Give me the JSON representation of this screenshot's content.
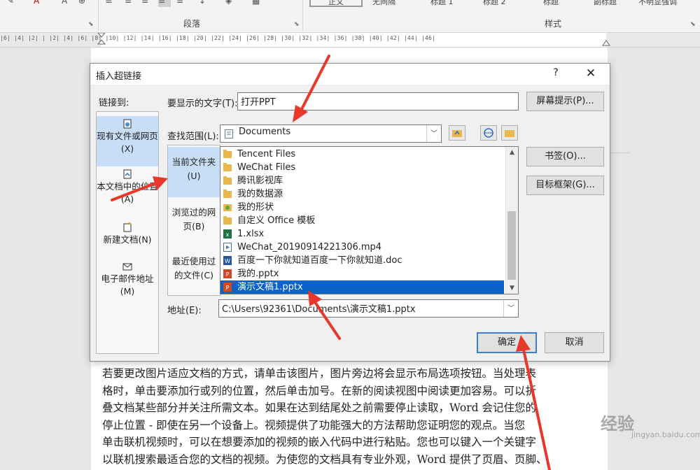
{
  "ribbon": {
    "paragraph_group": "段落",
    "styles_group": "样式",
    "style_items": [
      "正文",
      "无间隔",
      "标题 1",
      "标题 2",
      "标题",
      "副标题",
      "不明显强调"
    ]
  },
  "ruler": {
    "ticks": "|6| |4| |2| |  |2| |4| |6| |8| |10| |12| |14| |16| |18| |20| |22| |24| |26| |28| |30| |32| |34| |36| |38| |40| |42| |44| |46|"
  },
  "dialog": {
    "title": "插入超链接",
    "help": "?",
    "close": "✕",
    "link_to_label": "链接到:",
    "link_to_items": [
      {
        "label": "现有文件或网页(X)",
        "icon": "existing-file-icon",
        "selected": true
      },
      {
        "label": "本文档中的位置(A)",
        "icon": "document-place-icon",
        "selected": false
      },
      {
        "label": "新建文档(N)",
        "icon": "new-document-icon",
        "selected": false
      },
      {
        "label": "电子邮件地址(M)",
        "icon": "email-icon",
        "selected": false
      }
    ],
    "display_text_label": "要显示的文字(T):",
    "display_text_value": "打开PPT",
    "screentip_button": "屏幕提示(P)...",
    "look_in_label": "查找范围(L):",
    "look_in_value": "Documents",
    "nav_items": [
      {
        "label": "当前文件夹(U)",
        "selected": true
      },
      {
        "label": "浏览过的网页(B)",
        "selected": false
      },
      {
        "label": "最近使用过的文件(C)",
        "selected": false
      }
    ],
    "files": [
      {
        "name": "Tencent Files",
        "type": "folder"
      },
      {
        "name": "WeChat Files",
        "type": "folder"
      },
      {
        "name": "腾讯影视库",
        "type": "folder"
      },
      {
        "name": "我的数据源",
        "type": "folder"
      },
      {
        "name": "我的形状",
        "type": "shapes"
      },
      {
        "name": "自定义 Office 模板",
        "type": "folder"
      },
      {
        "name": "1.xlsx",
        "type": "xlsx"
      },
      {
        "name": "WeChat_20190914221306.mp4",
        "type": "mp4"
      },
      {
        "name": "百度一下你就知道百度一下你就知道.doc",
        "type": "doc"
      },
      {
        "name": "我的.pptx",
        "type": "pptx"
      },
      {
        "name": "演示文稿1.pptx",
        "type": "pptx",
        "selected": true
      }
    ],
    "bookmark_button": "书签(O)...",
    "target_frame_button": "目标框架(G)...",
    "address_label": "地址(E):",
    "address_value": "C:\\Users\\92361\\Documents\\演示文稿1.pptx",
    "ok_button": "确定",
    "cancel_button": "取消"
  },
  "document": {
    "lines": [
      "若要更改图片适应文档的方式，请单击该图片，图片旁边将会显示布局选项按钮。当处理表",
      "格时，单击要添加行或列的位置，然后单击加号。在新的阅读视图中阅读更加容易。可以折",
      "叠文档某些部分并关注所需文本。如果在达到结尾处之前需要停止读取，Word 会记住您的",
      "停止位置 - 即使在另一个设备上。视频提供了功能强大的方法帮助您证明您的观点。当您",
      "单击联机视频时，可以在想要添加的视频的嵌入代码中进行粘贴。您也可以键入一个关键字",
      "以联机搜索最适合您的文档的视频。为使您的文档具有专业外观，Word 提供了页眉、页脚、"
    ]
  },
  "watermark": {
    "text": "经验",
    "url": "jingyan.baidu.com"
  },
  "colors": {
    "selection_blue": "#0a63c6",
    "arrow_red": "#e8372b",
    "nav_selected": "#c7def6"
  }
}
